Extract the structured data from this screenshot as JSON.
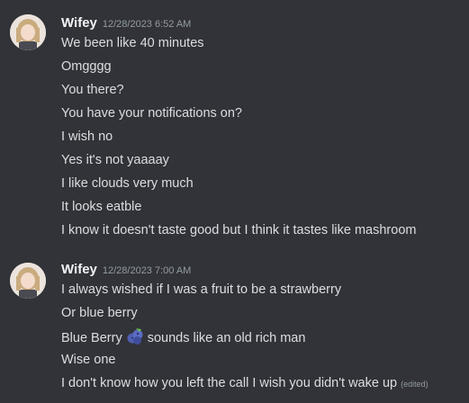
{
  "groups": [
    {
      "username": "Wifey",
      "timestamp": "12/28/2023 6:52 AM",
      "messages": [
        "We been like 40 minutes",
        "Omgggg",
        "You there?",
        "You have your notifications on?",
        "I wish no",
        "Yes it's not yaaaay",
        "I like clouds very much",
        "It looks eatble",
        "I know it doesn't taste good but I think it tastes like mashroom"
      ]
    },
    {
      "username": "Wifey",
      "timestamp": "12/28/2023 7:00 AM",
      "messages": [
        "I always wished if I was a fruit to be a strawberry",
        "Or blue berry",
        {
          "before": "Blue Berry",
          "emoji": "blueberries-emoji",
          "after": "sounds like an old rich man"
        },
        "Wise one",
        {
          "text": "I don't know how you left the call I wish you didn't wake up",
          "edited": "(edited)"
        }
      ]
    }
  ],
  "colors": {
    "background": "#313338",
    "username": "#f2f3f5",
    "text": "#dbdee1",
    "muted": "#949ba4"
  }
}
